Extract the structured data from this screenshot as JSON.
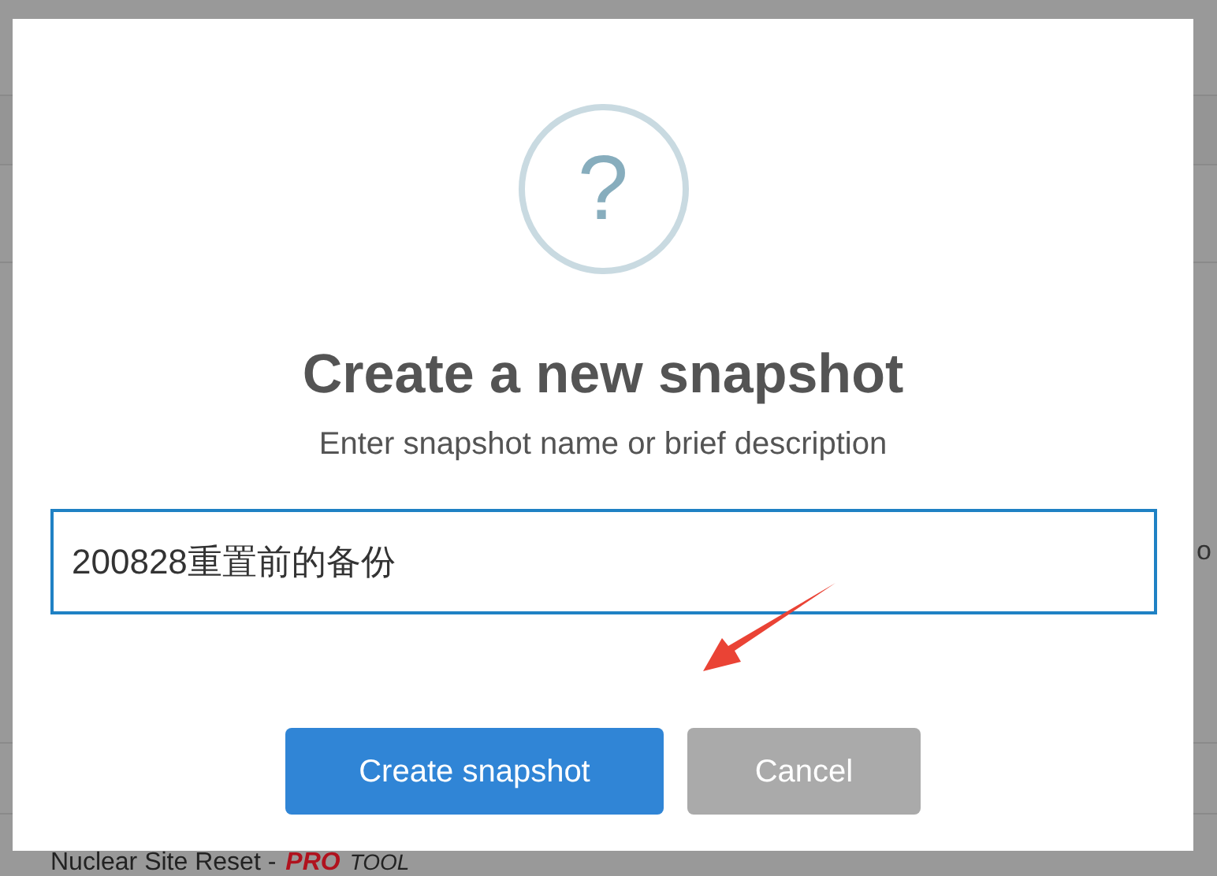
{
  "background": {
    "side_text": "o",
    "bottom_item": {
      "name": "Nuclear Site Reset -",
      "badge": "PRO",
      "suffix": "TOOL"
    }
  },
  "dialog": {
    "icon": "?",
    "title": "Create a new snapshot",
    "subtitle": "Enter snapshot name or brief description",
    "input": {
      "value": "200828重置前的备份"
    },
    "buttons": [
      {
        "label": "Create snapshot",
        "kind": "confirm"
      },
      {
        "label": "Cancel",
        "kind": "cancel"
      }
    ]
  }
}
